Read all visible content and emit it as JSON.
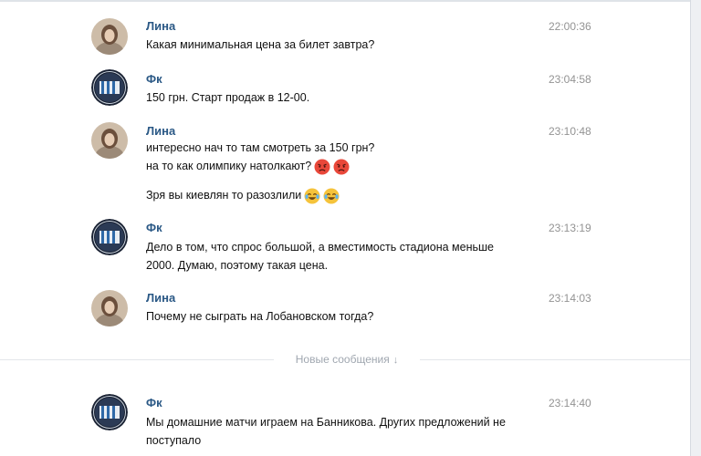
{
  "messages": [
    {
      "author": "Лина",
      "avatar": "user-photo-avatar",
      "time": "22:00:36",
      "lines": [
        "Какая минимальная цена за билет завтра?"
      ]
    },
    {
      "author": "Фк",
      "avatar": "club-logo-avatar",
      "time": "23:04:58",
      "lines": [
        "150 грн. Старт продаж в 12-00."
      ]
    },
    {
      "author": "Лина",
      "avatar": "user-photo-avatar",
      "time": "23:10:48",
      "lines": [
        "интересно нач то там смотреть за 150 грн?",
        "на то как олимпику натолкают?"
      ],
      "emoji_line2": [
        "angry-emoji",
        "angry-emoji"
      ],
      "extra_line": "Зря вы киевлян то разозлили",
      "emoji_extra": [
        "tears-of-joy-emoji",
        "tears-of-joy-emoji"
      ]
    },
    {
      "author": "Фк",
      "avatar": "club-logo-avatar",
      "time": "23:13:19",
      "lines": [
        "Дело в том, что спрос большой, а вместимость стадиона меньше",
        "2000. Думаю, поэтому такая цена."
      ]
    },
    {
      "author": "Лина",
      "avatar": "user-photo-avatar",
      "time": "23:14:03",
      "lines": [
        "Почему не сыграть на Лобановском тогда?"
      ]
    },
    {
      "author": "Фк",
      "avatar": "club-logo-avatar",
      "time": "23:14:40",
      "lines": [
        "Мы домашние матчи играем на Банникова. Других предложений не",
        "поступало"
      ]
    }
  ],
  "divider": {
    "label": "Новые сообщения",
    "icon": "arrow-down-icon"
  },
  "colors": {
    "author": "#2a5885",
    "time": "#939393",
    "divider_text": "#a0a7b0"
  }
}
